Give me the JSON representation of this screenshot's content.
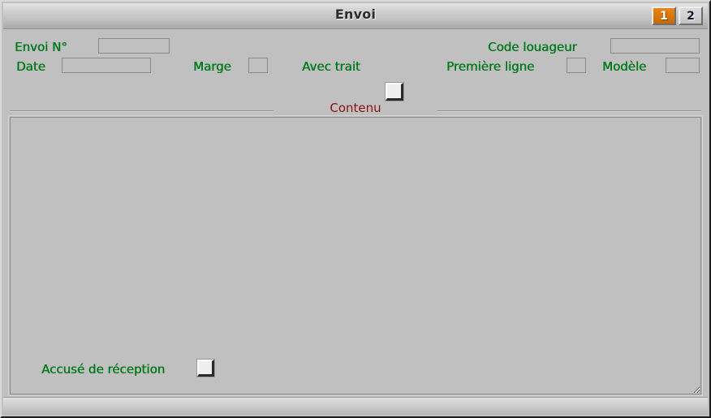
{
  "window": {
    "title": "Envoi",
    "colors": {
      "background": "#c0c0c0",
      "label_green": "#007a1c",
      "legend_red": "#8b1113",
      "tab_active": "#d97508",
      "title_text": "#2b2b2b"
    }
  },
  "tabs": [
    {
      "label": "1",
      "active": true
    },
    {
      "label": "2",
      "active": false
    }
  ],
  "fields": {
    "envoi_no": {
      "label": "Envoi N°",
      "value": "",
      "placeholder": ""
    },
    "date": {
      "label": "Date",
      "value": "",
      "placeholder": ""
    },
    "marge": {
      "label": "Marge",
      "value": "",
      "placeholder": ""
    },
    "avec_trait": {
      "label": "Avec trait",
      "checked": false,
      "focused": true
    },
    "code_louageur": {
      "label": "Code louageur",
      "value": "",
      "placeholder": ""
    },
    "premiere_ligne": {
      "label": "Première ligne",
      "value": "",
      "placeholder": ""
    },
    "modele": {
      "label": "Modèle",
      "value": "",
      "placeholder": ""
    },
    "accuse_reception": {
      "label": "Accusé de réception",
      "checked": false,
      "focused": false
    }
  },
  "content_group": {
    "legend": "Contenu",
    "text": "",
    "placeholder": ""
  }
}
